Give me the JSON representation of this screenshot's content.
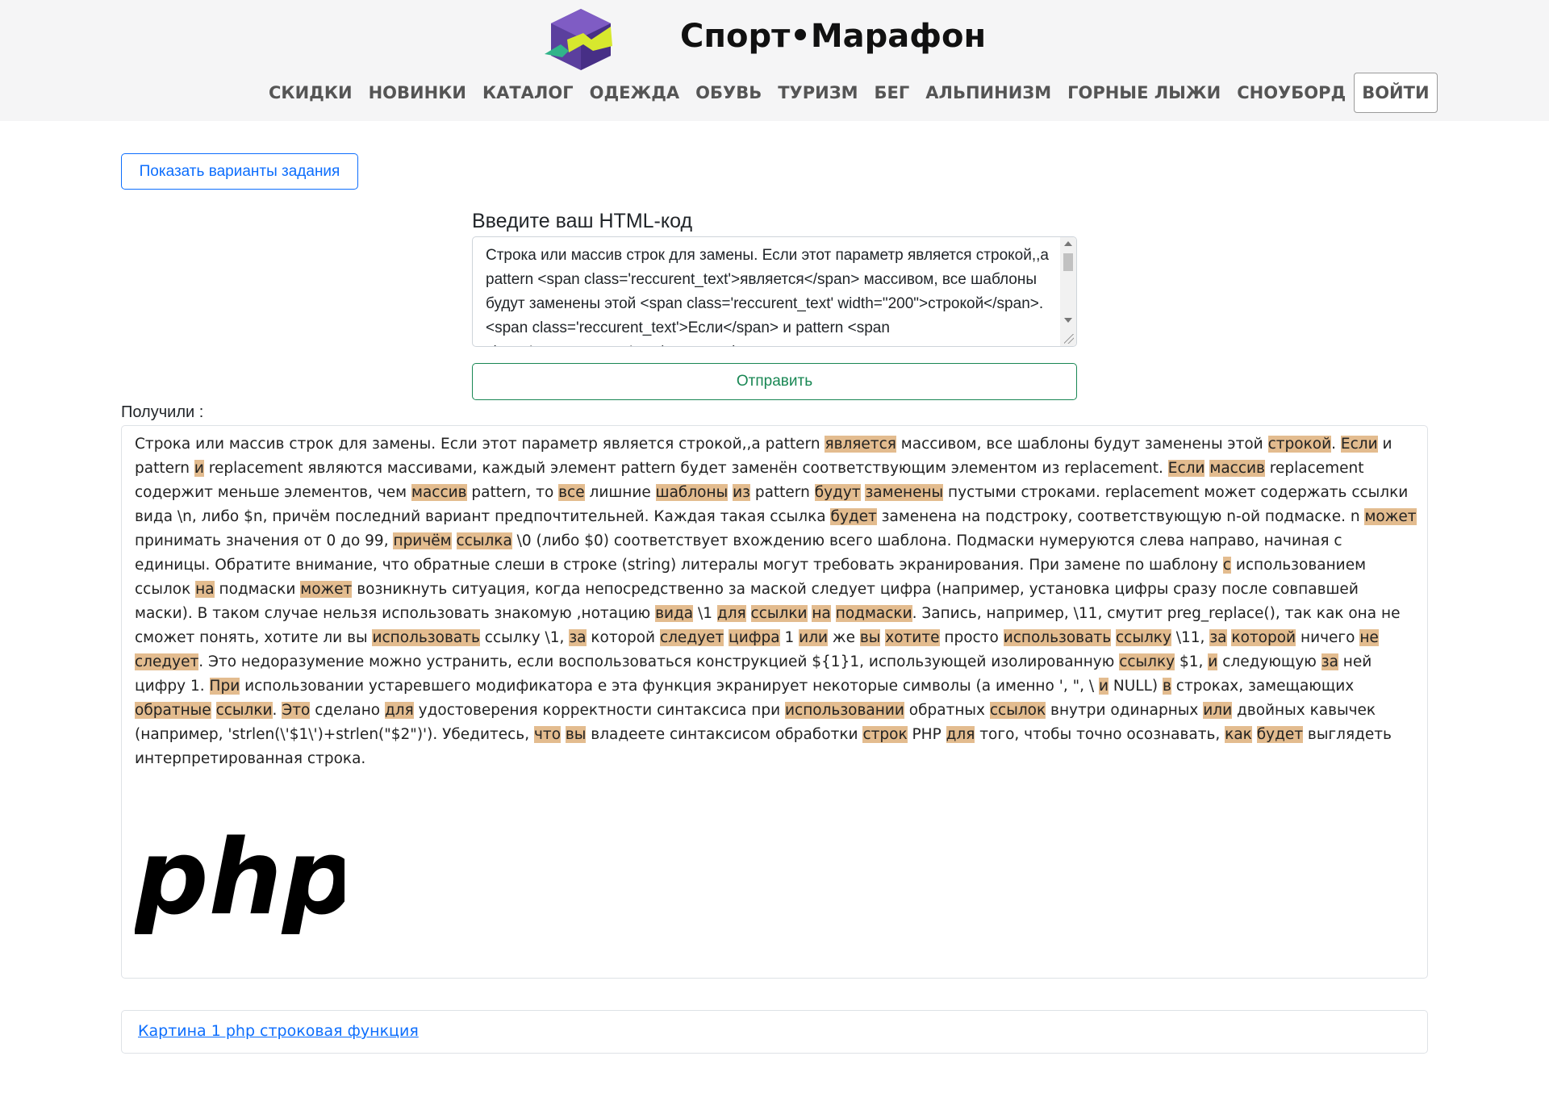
{
  "brand": {
    "name": "Спорт•Марафон",
    "logo": "hexagon-logo-icon"
  },
  "nav": {
    "items": [
      "СКИДКИ",
      "НОВИНКИ",
      "КАТАЛОГ",
      "ОДЕЖДА",
      "ОБУВЬ",
      "ТУРИЗМ",
      "БЕГ",
      "АЛЬПИНИЗМ",
      "ГОРНЫЕ ЛЫЖИ",
      "СНОУБОРД"
    ],
    "login": "ВОЙТИ"
  },
  "variants_button": "Показать варианты задания",
  "editor": {
    "title": "Введите ваш HTML-код",
    "value": "Строка или массив строк для замены. Если этот параметр является строкой,,а pattern <span class='reccurent_text'>является</span> массивом, все шаблоны будут заменены этой <span class='reccurent_text' width=\"200\">строкой</span>. <span class='reccurent_text'>Если</span> и pattern <span class='reccurent_text'>и</span> replacement являются массивами"
  },
  "submit_button": "Отправить",
  "result": {
    "label": "Получили :",
    "segments": [
      [
        "Строка или массив строк для замены. Если этот параметр является строкой,,а pattern ",
        0
      ],
      [
        "является",
        1
      ],
      [
        " массивом, все шаблоны будут заменены этой ",
        0
      ],
      [
        "строкой",
        1
      ],
      [
        ". ",
        0
      ],
      [
        "Если",
        1
      ],
      [
        " и pattern ",
        0
      ],
      [
        "и",
        1
      ],
      [
        " replacement являются массивами, каждый элемент pattern будет заменён соответствующим элементом из replacement. ",
        0
      ],
      [
        "Если",
        1
      ],
      [
        " ",
        0
      ],
      [
        "массив",
        1
      ],
      [
        " replacement содержит меньше элементов, чем ",
        0
      ],
      [
        "массив",
        1
      ],
      [
        " pattern, то ",
        0
      ],
      [
        "все",
        1
      ],
      [
        " лишние ",
        0
      ],
      [
        "шаблоны",
        1
      ],
      [
        " ",
        0
      ],
      [
        "из",
        1
      ],
      [
        " pattern ",
        0
      ],
      [
        "будут",
        1
      ],
      [
        " ",
        0
      ],
      [
        "заменены",
        1
      ],
      [
        " пустыми строками. replacement может содержать ссылки вида \\n, либо $n, причём последний вариант предпочтительней. Каждая такая ссылка ",
        0
      ],
      [
        "будет",
        1
      ],
      [
        " заменена на подстроку, соответствующую n-ой подмаске. n ",
        0
      ],
      [
        "может",
        1
      ],
      [
        " принимать значения от 0 до 99, ",
        0
      ],
      [
        "причём",
        1
      ],
      [
        " ",
        0
      ],
      [
        "ссылка",
        1
      ],
      [
        " \\0 (либо $0) соответствует вхождению всего шаблона. Подмаски нумеруются слева направо, начиная с единицы. Обратите внимание, что обратные слеши в строке (string) литералы могут требовать экранирования. При замене по шаблону ",
        0
      ],
      [
        "с",
        1
      ],
      [
        " использованием ссылок ",
        0
      ],
      [
        "на",
        1
      ],
      [
        " подмаски ",
        0
      ],
      [
        "может",
        1
      ],
      [
        " возникнуть ситуация, когда непосредственно за маской следует цифра (например, установка цифры сразу после совпавшей маски). В таком случае нельзя использовать знакомую ,нотацию ",
        0
      ],
      [
        "вида",
        1
      ],
      [
        " \\1 ",
        0
      ],
      [
        "для",
        1
      ],
      [
        " ",
        0
      ],
      [
        "ссылки",
        1
      ],
      [
        " ",
        0
      ],
      [
        "на",
        1
      ],
      [
        " ",
        0
      ],
      [
        "подмаски",
        1
      ],
      [
        ". Запись, например, \\11, смутит preg_replace(), так как она не сможет понять, хотите ли вы ",
        0
      ],
      [
        "использовать",
        1
      ],
      [
        " ссылку \\1, ",
        0
      ],
      [
        "за",
        1
      ],
      [
        " которой ",
        0
      ],
      [
        "следует",
        1
      ],
      [
        " ",
        0
      ],
      [
        "цифра",
        1
      ],
      [
        " 1 ",
        0
      ],
      [
        "или",
        1
      ],
      [
        " же ",
        0
      ],
      [
        "вы",
        1
      ],
      [
        " ",
        0
      ],
      [
        "хотите",
        1
      ],
      [
        " просто ",
        0
      ],
      [
        "использовать",
        1
      ],
      [
        " ",
        0
      ],
      [
        "ссылку",
        1
      ],
      [
        " \\11, ",
        0
      ],
      [
        "за",
        1
      ],
      [
        " ",
        0
      ],
      [
        "которой",
        1
      ],
      [
        " ничего ",
        0
      ],
      [
        "не",
        1
      ],
      [
        " ",
        0
      ],
      [
        "следует",
        1
      ],
      [
        ". Это недоразумение можно устранить, если воспользоваться конструкцией ${1}1, использующей изолированную ",
        0
      ],
      [
        "ссылку",
        1
      ],
      [
        " $1, ",
        0
      ],
      [
        "и",
        1
      ],
      [
        " следующую ",
        0
      ],
      [
        "за",
        1
      ],
      [
        " ней цифру 1. ",
        0
      ],
      [
        "При",
        1
      ],
      [
        " использовании устаревшего модификатора e эта функция экранирует некоторые символы (а именно ', \", \\ ",
        0
      ],
      [
        "и",
        1
      ],
      [
        " NULL) ",
        0
      ],
      [
        "в",
        1
      ],
      [
        " строках, замещающих ",
        0
      ],
      [
        "обратные",
        1
      ],
      [
        " ",
        0
      ],
      [
        "ссылки",
        1
      ],
      [
        ". ",
        0
      ],
      [
        "Это",
        1
      ],
      [
        " сделано ",
        0
      ],
      [
        "для",
        1
      ],
      [
        " удостоверения корректности синтаксиса при ",
        0
      ],
      [
        "использовании",
        1
      ],
      [
        " обратных ",
        0
      ],
      [
        "ссылок",
        1
      ],
      [
        " внутри одинарных ",
        0
      ],
      [
        "или",
        1
      ],
      [
        " двойных кавычек (например, 'strlen(\\'$1\\')+strlen(\"$2\")'). Убедитесь, ",
        0
      ],
      [
        "что",
        1
      ],
      [
        " ",
        0
      ],
      [
        "вы",
        1
      ],
      [
        " владеете синтаксисом обработки ",
        0
      ],
      [
        "строк",
        1
      ],
      [
        " PHP ",
        0
      ],
      [
        "для",
        1
      ],
      [
        " того, чтобы точно осознавать, ",
        0
      ],
      [
        "как",
        1
      ],
      [
        " ",
        0
      ],
      [
        "будет",
        1
      ],
      [
        " выглядеть интерпретированная строка.",
        0
      ]
    ],
    "image": "php-logo",
    "image_text": "php"
  },
  "caption_link": "Картина 1 php строковая функция",
  "colors": {
    "highlight": "#e3bc8f",
    "primary": "#0d6efd",
    "success": "#198754",
    "header_bg": "#f5f5f6"
  }
}
